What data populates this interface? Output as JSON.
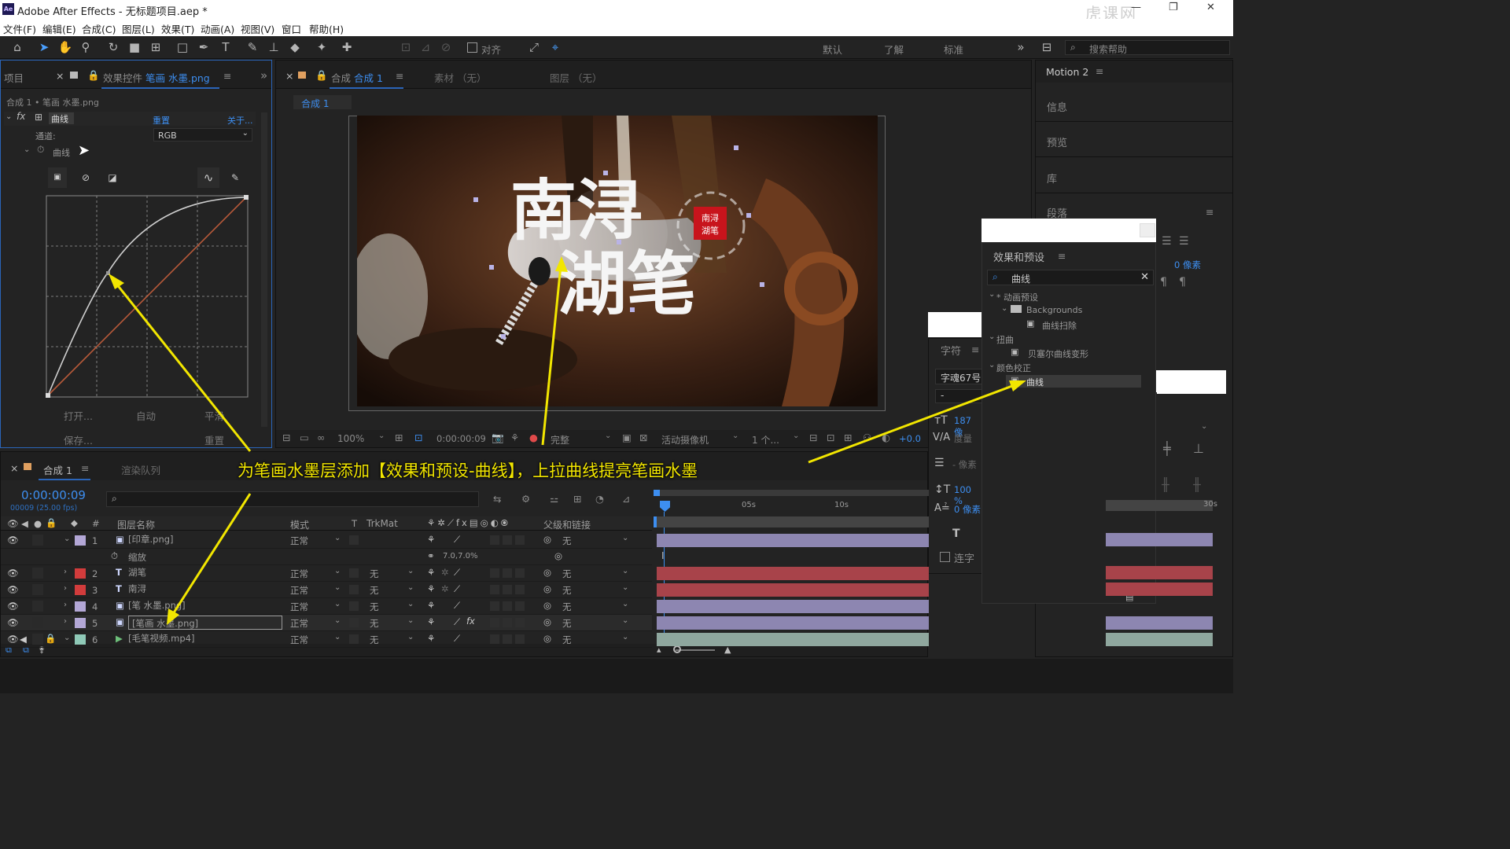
{
  "window": {
    "app_icon": "Ae",
    "title": "Adobe After Effects - 无标题项目.aep *",
    "watermark": "虎课网"
  },
  "menu": [
    "文件(F)",
    "编辑(E)",
    "合成(C)",
    "图层(L)",
    "效果(T)",
    "动画(A)",
    "视图(V)",
    "窗口",
    "帮助(H)"
  ],
  "toolbar": {
    "snap_label": "对齐",
    "workspaces": [
      "默认",
      "了解",
      "标准"
    ],
    "search_placeholder": "搜索帮助"
  },
  "left_panel": {
    "tab_project": "项目",
    "tab_effects": "效果控件",
    "tab_effects_target": "笔画 水墨.png",
    "breadcrumb": "合成 1 • 笔画 水墨.png",
    "fx_name": "曲线",
    "reset": "重置",
    "about": "关于...",
    "channel_label": "通道:",
    "channel_value": "RGB",
    "curve_label": "曲线",
    "btn_open": "打开...",
    "btn_auto": "自动",
    "btn_smooth": "平滑",
    "btn_save": "保存...",
    "btn_reset": "重置"
  },
  "comp_panel": {
    "tab_comp": "合成",
    "tab_comp_name": "合成 1",
    "tab_footage": "素材 （无）",
    "tab_layer": "图层 （无）",
    "sub_tab": "合成 1",
    "overlay_title_1": "南浔",
    "overlay_title_2": "湖笔",
    "seal_1": "南浔",
    "seal_2": "湖笔",
    "zoom": "100%",
    "timecode": "0:00:00:09",
    "resolution": "完整",
    "camera": "活动摄像机",
    "views": "1 个...",
    "exposure": "+0.0"
  },
  "right_panel": {
    "motion_tab": "Motion 2",
    "items": [
      "信息",
      "预览",
      "库",
      "段落"
    ],
    "para_value": "0 像素",
    "char_tab": "字符",
    "font": "字魂67号",
    "size_val": "187 像",
    "leading": "度量",
    "tracking": "- 像素",
    "scale": "100 %",
    "baseline": "0 像素",
    "ligature": "连字"
  },
  "effects_presets": {
    "title": "效果和预设",
    "search": "曲线",
    "tree": [
      {
        "label": "* 动画预设",
        "level": 0
      },
      {
        "label": "Backgrounds",
        "level": 1
      },
      {
        "label": "曲线扫除",
        "level": 2
      },
      {
        "label": "扭曲",
        "level": 0
      },
      {
        "label": "贝塞尔曲线变形",
        "level": 1
      },
      {
        "label": "颜色校正",
        "level": 0
      },
      {
        "label": "曲线",
        "level": 1
      }
    ]
  },
  "timeline": {
    "tab_comp": "合成 1",
    "tab_render": "渲染队列",
    "timecode": "0:00:00:09",
    "frame_info": "00009 (25.00 fps)",
    "headers": {
      "num": "#",
      "name": "图层名称",
      "mode": "模式",
      "t": "T",
      "trkmat": "TrkMat",
      "parent": "父级和链接"
    },
    "ruler": [
      "05s",
      "10s",
      "30s"
    ],
    "layers": [
      {
        "num": "1",
        "name": "[印章.png]",
        "mode": "正常",
        "trkmat": "",
        "parent": "无",
        "label_color": "#b3a7d6",
        "type": "img"
      },
      {
        "num": "",
        "name": "缩放",
        "mode": "",
        "trkmat": "",
        "parent": "",
        "value": "7.0,7.0%",
        "label_color": "",
        "type": "prop"
      },
      {
        "num": "2",
        "name": "湖笔",
        "mode": "正常",
        "trkmat": "无",
        "parent": "无",
        "label_color": "#d23c3c",
        "type": "text"
      },
      {
        "num": "3",
        "name": "南浔",
        "mode": "正常",
        "trkmat": "无",
        "parent": "无",
        "label_color": "#d23c3c",
        "type": "text"
      },
      {
        "num": "4",
        "name": "[笔 水墨.png]",
        "mode": "正常",
        "trkmat": "无",
        "parent": "无",
        "label_color": "#b3a7d6",
        "type": "img"
      },
      {
        "num": "5",
        "name": "[笔画 水墨.png]",
        "mode": "正常",
        "trkmat": "无",
        "parent": "无",
        "label_color": "#b3a7d6",
        "type": "img"
      },
      {
        "num": "6",
        "name": "[毛笔视频.mp4]",
        "mode": "正常",
        "trkmat": "无",
        "parent": "无",
        "label_color": "#8fc9b7",
        "type": "video"
      }
    ]
  },
  "annotation": "为笔画水墨层添加【效果和预设-曲线】，上拉曲线提亮笔画水墨",
  "colors": {
    "accent": "#3d8ef0",
    "annotation": "#f2e600",
    "track_red": "#a8434a",
    "track_purple": "#8d86b1"
  }
}
